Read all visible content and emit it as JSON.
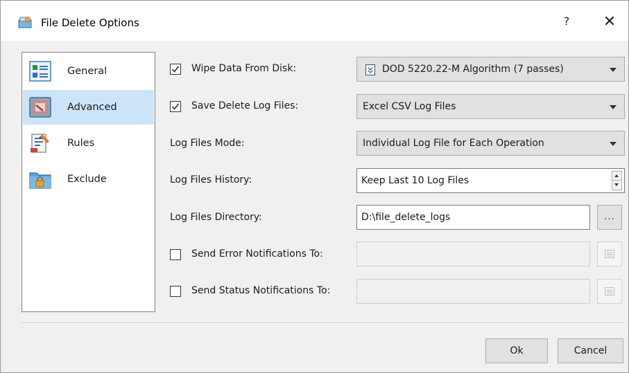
{
  "window": {
    "title": "File Delete Options",
    "help_label": "?",
    "close_label": "✕"
  },
  "nav": {
    "items": [
      {
        "label": "General",
        "icon": "general-settings-icon",
        "active": false
      },
      {
        "label": "Advanced",
        "icon": "advanced-settings-icon",
        "active": true
      },
      {
        "label": "Rules",
        "icon": "rules-icon",
        "active": false
      },
      {
        "label": "Exclude",
        "icon": "exclude-folder-lock-icon",
        "active": false
      }
    ]
  },
  "form": {
    "wipe_data": {
      "label": "Wipe Data From Disk:",
      "checked": true,
      "value": "DOD 5220.22-M Algorithm (7 passes)"
    },
    "save_log": {
      "label": "Save Delete Log Files:",
      "checked": true,
      "value": "Excel CSV Log Files"
    },
    "log_mode": {
      "label": "Log Files Mode:",
      "value": "Individual Log File for Each Operation"
    },
    "log_history": {
      "label": "Log Files History:",
      "value": "Keep Last 10 Log Files"
    },
    "log_dir": {
      "label": "Log Files Directory:",
      "value": "D:\\file_delete_logs",
      "browse_label": "..."
    },
    "error_notify": {
      "label": "Send Error Notifications To:",
      "checked": false,
      "value": ""
    },
    "status_notify": {
      "label": "Send Status Notifications To:",
      "checked": false,
      "value": ""
    }
  },
  "buttons": {
    "ok": "Ok",
    "cancel": "Cancel"
  },
  "colors": {
    "accent_selected": "#cce4f7",
    "dialog_bg": "#f0f0f0"
  }
}
